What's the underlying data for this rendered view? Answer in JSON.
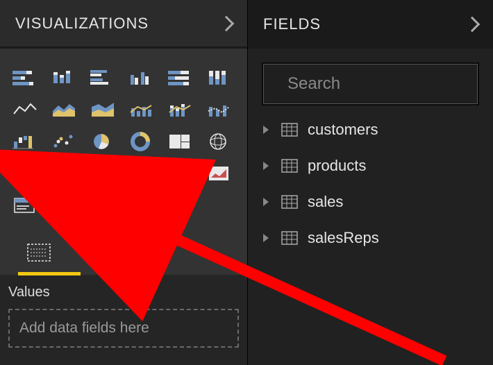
{
  "visualizations": {
    "title": "VISUALIZATIONS",
    "values_label": "Values",
    "drop_placeholder": "Add data fields here",
    "viz_names": [
      "stacked-bar",
      "stacked-column",
      "clustered-bar",
      "clustered-column",
      "100pct-stacked-bar",
      "100pct-stacked-column",
      "line",
      "area",
      "stacked-area",
      "line-clustered-column",
      "line-stacked-column",
      "ribbon",
      "waterfall",
      "scatter",
      "pie",
      "donut",
      "treemap",
      "map",
      "filled-map",
      "funnel",
      "gauge",
      "card",
      "multi-row-card",
      "kpi",
      "slicer",
      "table",
      "matrix",
      "r-script",
      "more"
    ]
  },
  "fields": {
    "title": "FIELDS",
    "search_placeholder": "Search",
    "tables": [
      "customers",
      "products",
      "sales",
      "salesReps"
    ]
  }
}
